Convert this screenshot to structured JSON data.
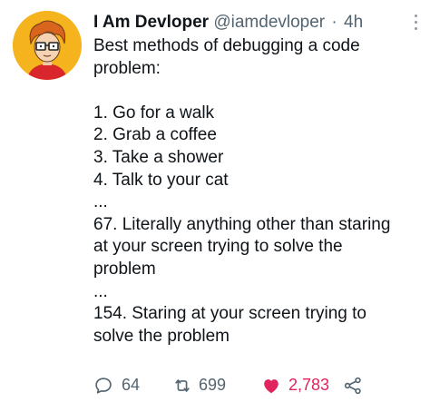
{
  "author": {
    "name": "I Am Devloper",
    "handle": "@iamdevloper",
    "separator": "·",
    "time": "4h"
  },
  "tweet": {
    "lines": [
      "Best methods of debugging a code",
      "problem:",
      "",
      "1. Go for a walk",
      "2. Grab a coffee",
      "3. Take a shower",
      "4. Talk to your cat",
      "...",
      "67. Literally anything other than staring",
      "at your screen trying to solve the",
      "problem",
      "...",
      "154. Staring at your screen trying to",
      "solve the problem"
    ]
  },
  "actions": {
    "replies": "64",
    "retweets": "699",
    "likes": "2,783",
    "liked": true,
    "icons": [
      "reply-icon",
      "retweet-icon",
      "heart-icon",
      "share-icon"
    ]
  },
  "colors": {
    "text": "#0f1419",
    "secondary": "#536471",
    "like": "#e0245e",
    "avatar_bg": "#f5b31e"
  }
}
